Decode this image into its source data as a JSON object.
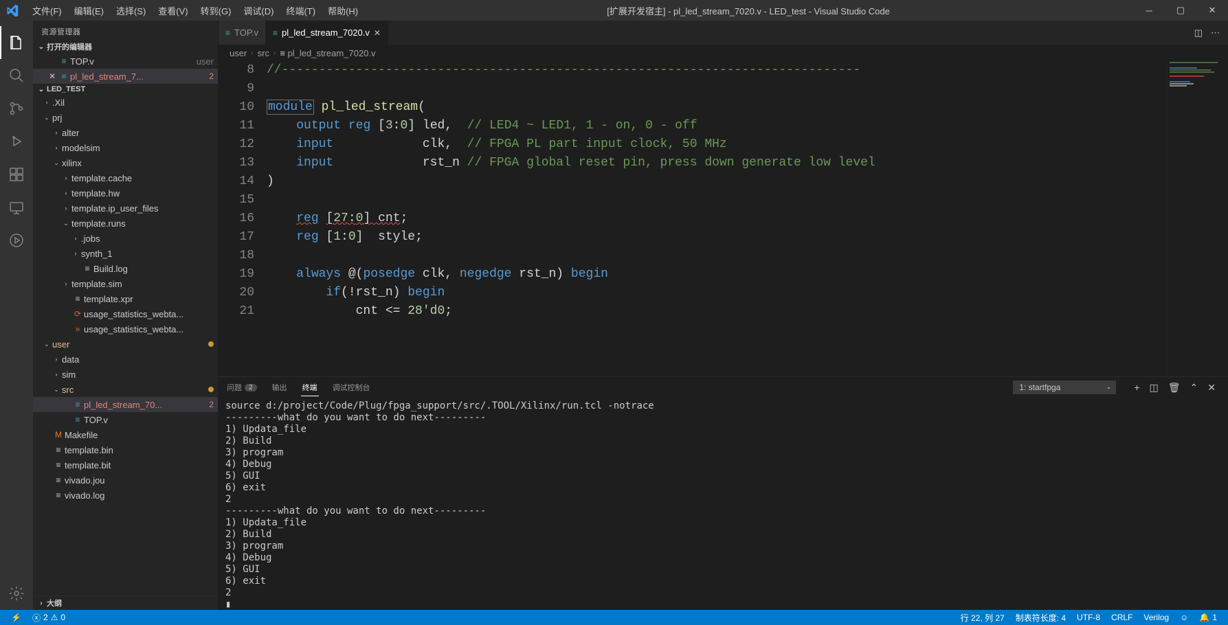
{
  "title": "[扩展开发宿主] - pl_led_stream_7020.v - LED_test - Visual Studio Code",
  "menus": [
    "文件(F)",
    "编辑(E)",
    "选择(S)",
    "查看(V)",
    "转到(G)",
    "调试(D)",
    "终端(T)",
    "帮助(H)"
  ],
  "sidebar": {
    "title": "资源管理器",
    "openEditors": {
      "header": "打开的编辑器"
    },
    "openItems": [
      {
        "label": "TOP.v",
        "suffix": "user",
        "close": false
      },
      {
        "label": "pl_led_stream_7...",
        "badge": "2",
        "close": true,
        "selected": true
      }
    ],
    "project": "LED_TEST",
    "tree": [
      {
        "depth": 0,
        "chev": "›",
        "label": ".Xil"
      },
      {
        "depth": 0,
        "chev": "⌄",
        "label": "prj"
      },
      {
        "depth": 1,
        "chev": "›",
        "label": "alter"
      },
      {
        "depth": 1,
        "chev": "›",
        "label": "modelsim"
      },
      {
        "depth": 1,
        "chev": "⌄",
        "label": "xilinx"
      },
      {
        "depth": 2,
        "chev": "›",
        "label": "template.cache"
      },
      {
        "depth": 2,
        "chev": "›",
        "label": "template.hw"
      },
      {
        "depth": 2,
        "chev": "›",
        "label": "template.ip_user_files"
      },
      {
        "depth": 2,
        "chev": "⌄",
        "label": "template.runs"
      },
      {
        "depth": 3,
        "chev": "›",
        "label": ".jobs"
      },
      {
        "depth": 3,
        "chev": "›",
        "label": "synth_1"
      },
      {
        "depth": 3,
        "chev": "",
        "icon": "≡",
        "label": "Build.log"
      },
      {
        "depth": 2,
        "chev": "›",
        "label": "template.sim"
      },
      {
        "depth": 2,
        "chev": "",
        "icon": "≡",
        "label": "template.xpr"
      },
      {
        "depth": 2,
        "chev": "",
        "icon": "⟳",
        "iconColor": "#cc6633",
        "label": "usage_statistics_webta..."
      },
      {
        "depth": 2,
        "chev": "",
        "icon": "»",
        "iconColor": "#cc6633",
        "label": "usage_statistics_webta..."
      },
      {
        "depth": 0,
        "chev": "⌄",
        "label": "user",
        "dot": true,
        "labelColor": "#e2c08d"
      },
      {
        "depth": 1,
        "chev": "›",
        "label": "data"
      },
      {
        "depth": 1,
        "chev": "›",
        "label": "sim"
      },
      {
        "depth": 1,
        "chev": "⌄",
        "label": "src",
        "dot": true,
        "labelColor": "#e2c08d"
      },
      {
        "depth": 2,
        "chev": "",
        "icon": "≡",
        "iconColor": "#519aba",
        "label": "pl_led_stream_70...",
        "badge": "2",
        "selected": true,
        "labelColor": "#e2857b"
      },
      {
        "depth": 2,
        "chev": "",
        "icon": "≡",
        "iconColor": "#519aba",
        "label": "TOP.v"
      },
      {
        "depth": 0,
        "chev": "",
        "icon": "M",
        "iconColor": "#e37933",
        "label": "Makefile"
      },
      {
        "depth": 0,
        "chev": "",
        "icon": "≡",
        "label": "template.bin"
      },
      {
        "depth": 0,
        "chev": "",
        "icon": "≡",
        "label": "template.bit"
      },
      {
        "depth": 0,
        "chev": "",
        "icon": "≡",
        "label": "vivado.jou"
      },
      {
        "depth": 0,
        "chev": "",
        "icon": "≡",
        "label": "vivado.log"
      }
    ],
    "outline": "大纲"
  },
  "tabs": [
    {
      "label": "TOP.v",
      "active": false
    },
    {
      "label": "pl_led_stream_7020.v",
      "active": true
    }
  ],
  "breadcrumbs": [
    "user",
    "src",
    "pl_led_stream_7020.v"
  ],
  "lineStart": 8,
  "code": [
    {
      "n": 8,
      "html": "<span class='c-comment'>//------------------------------------------------------------------------------</span>"
    },
    {
      "n": 9,
      "html": ""
    },
    {
      "n": 10,
      "html": "<span class='c-keyword mod-box'>module</span> <span class='c-func'>pl_led_stream</span>("
    },
    {
      "n": 11,
      "html": "    <span class='c-keyword'>output</span> <span class='c-type'>reg</span> [<span class='c-num'>3</span>:<span class='c-num'>0</span>] led,  <span class='c-comment'>// LED4 ~ LED1, 1 - on, 0 - off</span>"
    },
    {
      "n": 12,
      "html": "    <span class='c-keyword'>input</span>            clk,  <span class='c-comment'>// FPGA PL part input clock, 50 MHz</span>"
    },
    {
      "n": 13,
      "html": "    <span class='c-keyword'>input</span>            rst_n <span class='c-comment'>// FPGA global reset pin, press down generate low level</span>"
    },
    {
      "n": 14,
      "html": ")"
    },
    {
      "n": 15,
      "html": ""
    },
    {
      "n": 16,
      "html": "    <span class='c-type wavy'>reg</span> <span class='wavy'>[</span><span class='c-num wavy'>27</span><span class='wavy'>:</span><span class='c-num wavy'>0</span><span class='wavy'>] cnt</span>;"
    },
    {
      "n": 17,
      "html": "    <span class='c-type'>reg</span> [<span class='c-num'>1</span>:<span class='c-num'>0</span>]  style;"
    },
    {
      "n": 18,
      "html": ""
    },
    {
      "n": 19,
      "html": "    <span class='c-keyword'>always</span> @(<span class='c-keyword'>posedge</span> clk, <span class='c-keyword'>negedge</span> rst_n) <span class='c-keyword'>begin</span>"
    },
    {
      "n": 20,
      "html": "        <span class='c-keyword'>if</span>(!rst_n) <span class='c-keyword'>begin</span>"
    },
    {
      "n": 21,
      "html": "            cnt &lt;= <span class='c-num'>28'd0</span>;"
    }
  ],
  "panel": {
    "tabs": [
      {
        "label": "问题",
        "badge": "2"
      },
      {
        "label": "输出"
      },
      {
        "label": "终端",
        "active": true
      },
      {
        "label": "调试控制台"
      }
    ],
    "select": "1: startfpga",
    "body": "source d:/project/Code/Plug/fpga_support/src/.TOOL/Xilinx/run.tcl -notrace\n---------what do you want to do next---------\n1) Updata_file\n2) Build\n3) program\n4) Debug\n5) GUI\n6) exit\n2\n---------what do you want to do next---------\n1) Updata_file\n2) Build\n3) program\n4) Debug\n5) GUI\n6) exit\n2\n▮"
  },
  "status": {
    "errors": "2",
    "warnings": "0",
    "pos": "行 22,   列 27",
    "tab": "制表符长度: 4",
    "enc": "UTF-8",
    "eol": "CRLF",
    "lang": "Verilog",
    "feedback": "☺",
    "bell": "1"
  }
}
